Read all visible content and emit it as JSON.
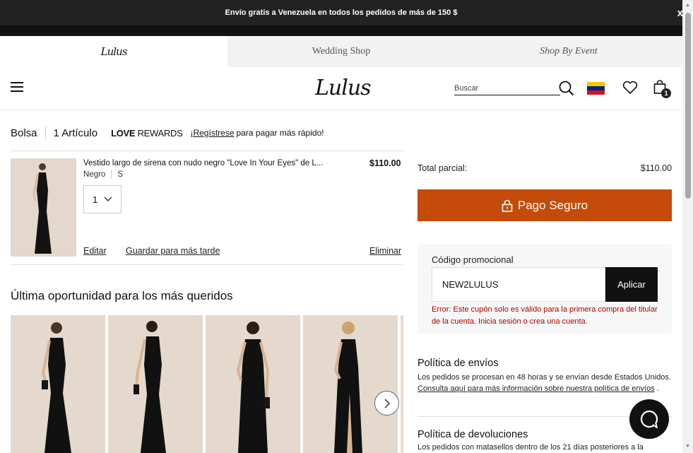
{
  "promo_bar": {
    "text": "Envío gratis a Venezuela en todos los pedidos de más de 150 $",
    "close": "x"
  },
  "brand_tabs": [
    {
      "label": "Lulus",
      "active": true
    },
    {
      "label": "Wedding Shop",
      "active": false
    },
    {
      "label": "Shop By Event",
      "active": false
    }
  ],
  "header": {
    "logo": "Lulus",
    "search_placeholder": "Buscar",
    "bag_count": "1",
    "flag_colors": [
      "#f4c400",
      "#00247d",
      "#cf142b"
    ]
  },
  "bag": {
    "title": "Bolsa",
    "item_count": "1 Artículo",
    "rewards_bold": "LOVE",
    "rewards_light": "REWARDS",
    "register_link": "¡Regístrese",
    "register_text": "para pagar más rápido!"
  },
  "cart_item": {
    "name": "Vestido largo de sirena con nudo negro \"Love In Your Eyes\" de L...",
    "price": "$110.00",
    "color": "Negro",
    "size": "S",
    "quantity": "1",
    "actions": {
      "edit": "Editar",
      "save_later": "Guardar para más tarde",
      "remove": "Eliminar"
    }
  },
  "recommendations": {
    "title": "Última oportunidad para los más queridos",
    "item_count": 4
  },
  "summary": {
    "subtotal_label": "Total parcial:",
    "subtotal_value": "$110.00",
    "checkout_label": "Pago Seguro",
    "checkout_color": "#c44b0a"
  },
  "promo": {
    "label": "Código promocional",
    "value": "NEW2LULUS",
    "apply": "Aplicar",
    "error": "Error: Este cupón solo es válido para la primera compra del titular de la cuenta. Inicia sesión o crea una cuenta.",
    "error_color": "#b00000"
  },
  "shipping_policy": {
    "title": "Política de envíos",
    "text_before": "Los pedidos se procesan en 48 horas y se envían desde Estados Unidos.",
    "link": "Consulta aquí para más información sobre nuestra política de envíos",
    "text_after": "."
  },
  "returns_policy": {
    "title": "Política de devoluciones",
    "text": "Los pedidos con matasellos dentro de los 21 días posteriores a la"
  }
}
